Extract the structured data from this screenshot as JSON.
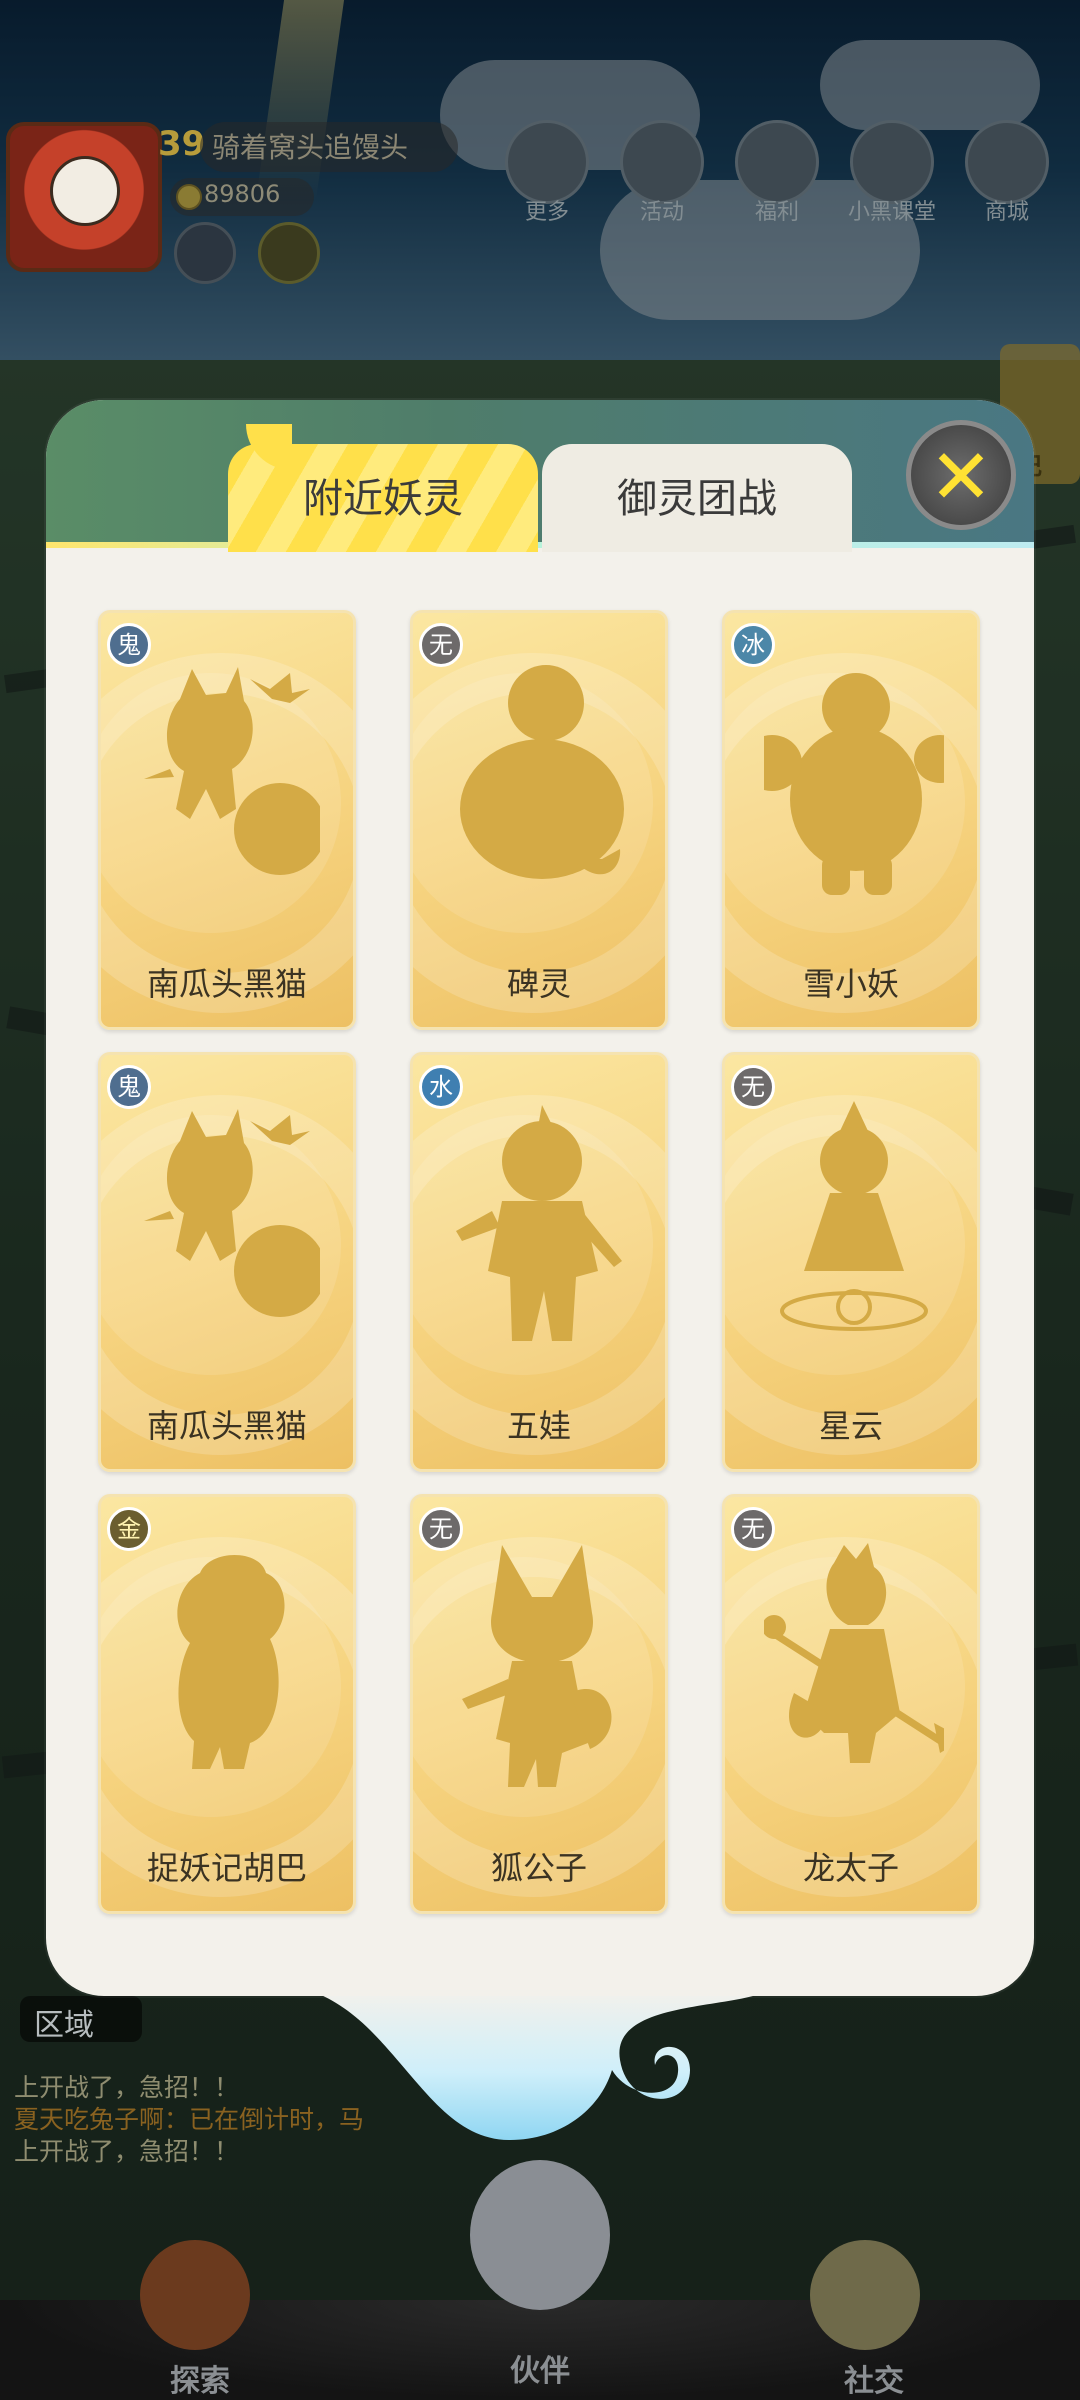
{
  "player": {
    "level": "39",
    "name": "骑着窝头追馒头",
    "coins": "89806"
  },
  "hud_buttons": [
    {
      "label": "更多",
      "icon": "grid-icon"
    },
    {
      "label": "活动",
      "icon": "gift-icon"
    },
    {
      "label": "福利",
      "icon": "star-box-icon"
    },
    {
      "label": "小黑课堂",
      "icon": "black-cat-icon"
    },
    {
      "label": "商城",
      "icon": "shop-icon"
    }
  ],
  "side_panel": {
    "label": "记"
  },
  "modal": {
    "tabs": {
      "nearby": "附近妖灵",
      "team_battle": "御灵团战"
    },
    "close_icon": "close-icon",
    "cards": [
      {
        "element": "鬼",
        "name": "南瓜头黑猫"
      },
      {
        "element": "无",
        "name": "碑灵"
      },
      {
        "element": "冰",
        "name": "雪小妖"
      },
      {
        "element": "鬼",
        "name": "南瓜头黑猫"
      },
      {
        "element": "水",
        "name": "五娃"
      },
      {
        "element": "无",
        "name": "星云"
      },
      {
        "element": "金",
        "name": "捉妖记胡巴"
      },
      {
        "element": "无",
        "name": "狐公子"
      },
      {
        "element": "无",
        "name": "龙太子"
      }
    ]
  },
  "region": {
    "label": "区域"
  },
  "chat": [
    "上开战了，急招！！",
    "夏天吃兔子啊：已在倒计时，马",
    "上开战了，急招！！"
  ],
  "bottom_nav": {
    "explore": "探索",
    "partner": "伙伴",
    "social": "社交"
  },
  "colors": {
    "tab_active": "#ffe04a",
    "card_gold": "#f6d37f",
    "silhouette": "#d4aa45",
    "close_x": "#ffe233"
  }
}
